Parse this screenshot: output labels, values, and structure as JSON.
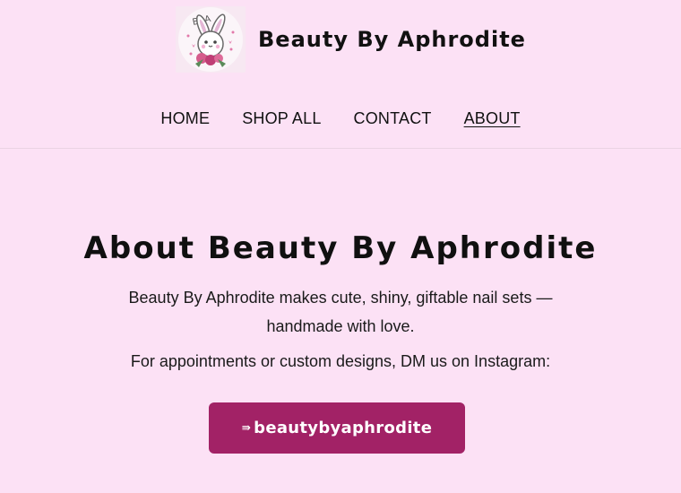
{
  "header": {
    "brand_name": "Beauty By Aphrodite",
    "logo_text": "BBA",
    "logo_icon": "bunny-rose-logo"
  },
  "nav": {
    "items": [
      {
        "label": "HOME",
        "active": false
      },
      {
        "label": "SHOP ALL",
        "active": false
      },
      {
        "label": "CONTACT",
        "active": false
      },
      {
        "label": "ABOUT",
        "active": true
      }
    ]
  },
  "about": {
    "title": "About Beauty By Aphrodite",
    "intro": "Beauty By Aphrodite makes cute, shiny, giftable nail sets — handmade with love.",
    "contact": "For appointments or custom designs, DM us on Instagram:"
  },
  "cta": {
    "icon_name": "instagram-icon",
    "icon_glyph": "⇛",
    "label": "beautybyaphrodite"
  },
  "colors": {
    "background": "#fce1f5",
    "button": "#a22266",
    "text": "#121212"
  }
}
